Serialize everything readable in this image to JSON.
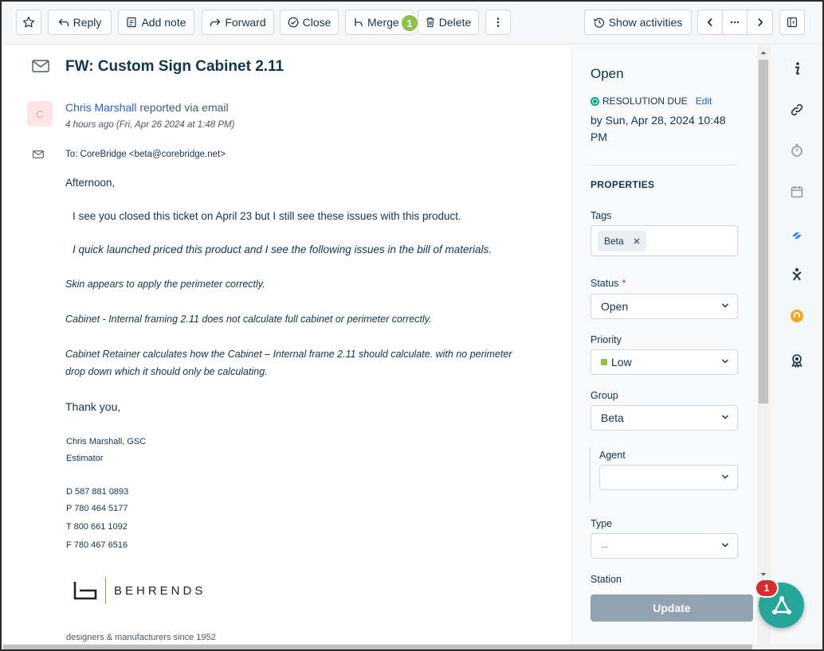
{
  "toolbar": {
    "reply": "Reply",
    "add_note": "Add note",
    "forward": "Forward",
    "close": "Close",
    "merge": "Merge",
    "merge_badge": "1",
    "delete": "Delete",
    "show_activities": "Show activities"
  },
  "ticket": {
    "subject": "FW: Custom Sign Cabinet 2.11",
    "avatar_initial": "C",
    "sender_name": "Chris Marshall",
    "sender_via": "reported via email",
    "time": "4 hours ago (Fri, Apr 26 2024 at 1:48 PM)",
    "to": "To: CoreBridge <beta@corebridge.net>",
    "body": {
      "greeting": "Afternoon,",
      "p1": "I see you closed this ticket on April 23 but I still see these issues with this product.",
      "p2": "I quick launched priced this product and I see the following issues in the bill of materials.",
      "p3": "Skin appears to apply the perimeter correctly.",
      "p4": "Cabinet - Internal framing 2.11 does not calculate full cabinet or perimeter correctly.",
      "p5a": "Cabinet Retainer calculates how the Cabinet – Internal frame 2.11 should calculate. with no perimeter",
      "p5b": "drop down which it should only be calculating.",
      "thanks": "Thank you,"
    },
    "signature": {
      "name": "Chris Marshall, GSC",
      "title": "Estimator",
      "d": "D 587 881 0893",
      "p": "P  780 464 5177",
      "t": "T  800 661 1092",
      "f": "F  780 467 6516",
      "logo_text": "BEHRENDS",
      "tagline": "designers & manufacturers since 1952"
    }
  },
  "panel": {
    "status_title": "Open",
    "resolution_label": "RESOLUTION DUE",
    "resolution_edit": "Edit",
    "resolution_due": "by Sun, Apr 28, 2024 10:48 PM",
    "properties_title": "PROPERTIES",
    "tags_label": "Tags",
    "tag_value": "Beta",
    "status_label": "Status",
    "status_required": "*",
    "status_value": "Open",
    "priority_label": "Priority",
    "priority_value": "Low",
    "priority_color": "#8bc34a",
    "group_label": "Group",
    "group_value": "Beta",
    "agent_label": "Agent",
    "agent_value": "",
    "type_label": "Type",
    "type_value": "--",
    "station_label": "Station",
    "update_button": "Update"
  },
  "fab": {
    "badge": "1"
  },
  "colors": {
    "accent": "#2c5cc5",
    "fab": "#26a69a",
    "badge": "#d72d30",
    "merge_badge": "#8bc34a"
  }
}
